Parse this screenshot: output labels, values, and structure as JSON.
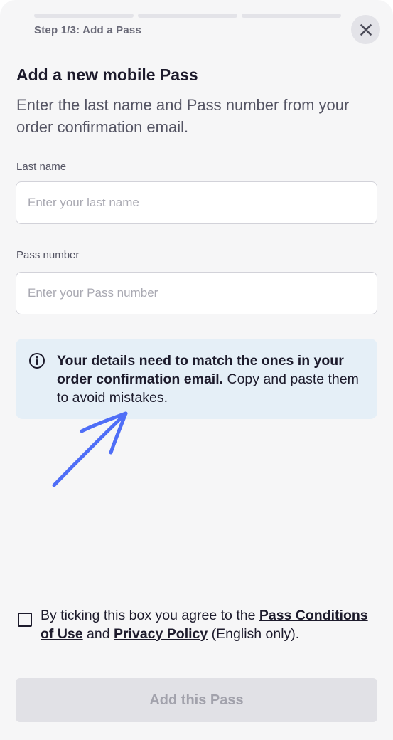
{
  "header": {
    "step_label": "Step 1/3: Add a Pass",
    "progress_steps": 3,
    "close_icon": "close-icon"
  },
  "main": {
    "title": "Add a new mobile Pass",
    "subtitle": "Enter the last name and Pass number from your order confirmation email."
  },
  "form": {
    "last_name": {
      "label": "Last name",
      "placeholder": "Enter your last name",
      "value": ""
    },
    "pass_number": {
      "label": "Pass number",
      "placeholder": "Enter your Pass number",
      "value": ""
    }
  },
  "info": {
    "icon": "info-icon",
    "bold_text": "Your details need to match the ones in your order confirmation email.",
    "rest_text": " Copy and paste them to avoid mistakes."
  },
  "annotation": {
    "arrow_color": "#4f6ef7"
  },
  "consent": {
    "checked": false,
    "prefix": "By ticking this box you agree to the ",
    "link1": "Pass Conditions of Use",
    "middle": " and ",
    "link2": "Privacy Policy",
    "suffix": " (English only)."
  },
  "footer": {
    "submit_label": "Add this Pass"
  },
  "colors": {
    "background": "#f6f6f7",
    "info_bg": "#e5eff7",
    "text_primary": "#1d1b2c",
    "button_disabled_bg": "#e1e1e6",
    "button_disabled_text": "#a2a2ac"
  }
}
